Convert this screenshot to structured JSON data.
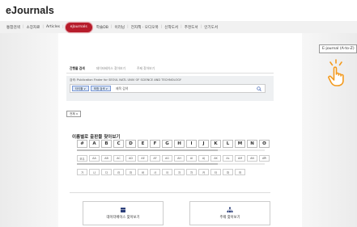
{
  "header": {
    "title": "eJournals"
  },
  "nav": {
    "items": [
      {
        "label": "통합검색",
        "active": false
      },
      {
        "label": "소장자료",
        "active": false
      },
      {
        "label": "Articles",
        "active": false
      },
      {
        "label": "eJournals",
        "active": true
      },
      {
        "label": "학술DB",
        "active": false
      },
      {
        "label": "이러닝",
        "active": false
      },
      {
        "label": "전자책 · 오디오북",
        "active": false
      },
      {
        "label": "신착도서",
        "active": false
      },
      {
        "label": "추천도서",
        "active": false
      },
      {
        "label": "인기도서",
        "active": false
      }
    ]
  },
  "az_button": {
    "label": "E-journal (A-to-Z)"
  },
  "tabs": [
    {
      "label": "간행물 검색",
      "active": true
    },
    {
      "label": "데이터베이스 찾아보기",
      "active": false
    },
    {
      "label": "주제 찾아보기",
      "active": false
    }
  ],
  "search": {
    "finder_text": "검색: Publication Finder for SEOUL NATL UNIV OF SCIENCE AND TECHNOLOGY",
    "field_select": "타이틀 ∨",
    "match_select": "포함 검색 ∨",
    "placeholder": "제목 검색"
  },
  "all_select": "전체 ∨",
  "alpha": {
    "title": "이름별로 출판물 찾아보기",
    "letters": [
      "#",
      "A",
      "B",
      "C",
      "D",
      "E",
      "F",
      "G",
      "H",
      "I",
      "J",
      "K",
      "L",
      "M",
      "N",
      "O"
    ],
    "sub_items": [
      "모두",
      "AA",
      "AB",
      "AC",
      "AD",
      "AE",
      "AF",
      "AG",
      "AH",
      "AI",
      "AJ",
      "AK",
      "AL",
      "AM",
      "AN",
      "AO"
    ],
    "korean": [
      "가",
      "나",
      "다",
      "라",
      "마",
      "바",
      "사",
      "아",
      "자",
      "차",
      "카",
      "타",
      "파",
      "하"
    ]
  },
  "buttons": {
    "database": "데이터베이스 찾아보기",
    "subject": "주제 찾아보기"
  },
  "colors": {
    "accent": "#b71c2b",
    "link_blue": "#1a3a8a",
    "hand_orange": "#f39a1e"
  }
}
